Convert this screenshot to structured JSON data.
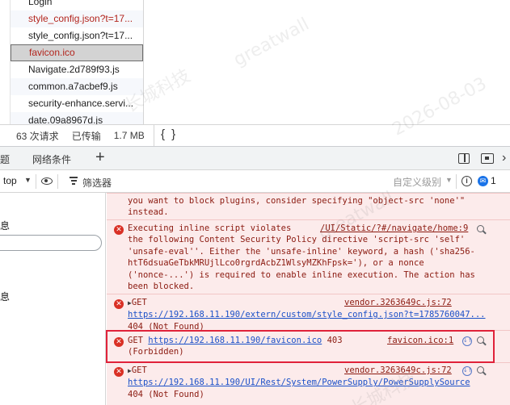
{
  "network": {
    "files": [
      {
        "name": "Login",
        "status": "normal",
        "alt": false
      },
      {
        "name": "style_config.json?t=17...",
        "status": "error",
        "alt": true
      },
      {
        "name": "style_config.json?t=17...",
        "status": "normal",
        "alt": false
      },
      {
        "name": "favicon.ico",
        "status": "selected-error",
        "alt": false
      },
      {
        "name": "Navigate.2d789f93.js",
        "status": "normal",
        "alt": false
      },
      {
        "name": "common.a7acbef9.js",
        "status": "normal",
        "alt": true
      },
      {
        "name": "security-enhance.servi...",
        "status": "normal",
        "alt": false
      },
      {
        "name": "date.09a8967d.js",
        "status": "normal",
        "alt": true
      }
    ],
    "status_bar": {
      "requests": "63 次请求",
      "transferred": "已传输",
      "size": "1.7 MB",
      "braces": "{ }"
    }
  },
  "drawer": {
    "tab_cut": "题",
    "tab_network_conditions": "网络条件",
    "add_tab": "+",
    "more": "›"
  },
  "console_toolbar": {
    "context": "top",
    "filter_placeholder": "筛选器",
    "levels": "自定义级别",
    "info": "i",
    "issues_count": "1",
    "issues_badge": "✉"
  },
  "console_side": {
    "label_1": "息",
    "label_2": "息"
  },
  "messages": [
    {
      "lines": [
        "you want to block plugins, consider specifying \"object-src 'none'\"",
        "instead."
      ]
    },
    {
      "source": "/UI/Static/?#/navigate/home:9",
      "lines": [
        "Executing inline script violates",
        "the following Content Security Policy directive 'script-src 'self'",
        "'unsafe-eval''. Either the 'unsafe-inline' keyword, a hash ('sha256-",
        "htT6dsuaGeTbkMRUjlLco0rgrdAcbZ1WlsyMZKhFpsk='), or a nonce",
        "('nonce-...') is required to enable inline execution. The action has",
        "been blocked."
      ]
    },
    {
      "method": "GET",
      "source": "vendor.3263649c.js:72",
      "url": "https://192.168.11.190/extern/custom/style_config.json?t=1785760047...",
      "status": "404 (Not Found)"
    },
    {
      "method": "GET",
      "url": "https://192.168.11.190/favicon.ico",
      "code": "403",
      "source": "favicon.ico:1",
      "status": "(Forbidden)"
    },
    {
      "method": "GET",
      "source": "vendor.3263649c.js:72",
      "url": "https://192.168.11.190/UI/Rest/System/PowerSupply/PowerSupplySource",
      "status": "404 (Not Found)"
    }
  ],
  "icons": {
    "error": "✕",
    "expand": "▶",
    "dropdown": "▼"
  },
  "colors": {
    "error_text": "#8b1a10",
    "error_bg": "#fcebeb",
    "highlight": "#e0223a",
    "link_blue": "#1a50c8"
  },
  "watermark": {
    "cn": "长城科技",
    "en": "greatwall",
    "date": "2026-08-03"
  }
}
